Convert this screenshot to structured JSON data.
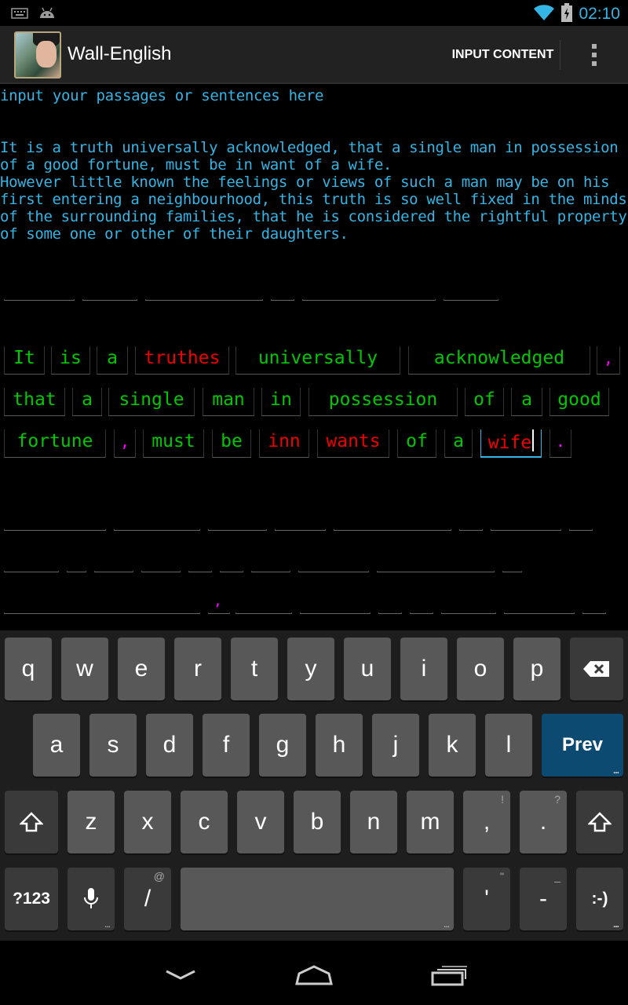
{
  "status_bar": {
    "time": "02:10",
    "icons": [
      "keyboard-icon",
      "android-icon",
      "wifi-icon",
      "battery-icon"
    ]
  },
  "action_bar": {
    "title": "Wall-English",
    "action_label": "INPUT CONTENT",
    "overflow_icon": "overflow-menu-icon"
  },
  "content": {
    "prompt": "input your passages or sentences here",
    "passage": "It is a truth universally acknowledged, that a single man in possession\nof a good fortune, must be in want of a wife.\nHowever little known the feelings or views of such a man may be on his\nfirst entering a neighbourhood, this truth is so well fixed in the minds\nof the surrounding families, that he is considered the rightful property\nof some one or other of their daughters.",
    "words_row1": [
      "It",
      "is",
      "a",
      "truthes",
      "universally",
      "acknowledged",
      ","
    ],
    "words_row2": [
      "that",
      "a",
      "single",
      "man",
      "in",
      "possession",
      "of",
      "a",
      "good"
    ],
    "words_row3": [
      "fortune",
      ",",
      "must",
      "be",
      "inn",
      "wants",
      "of",
      "a",
      "wife",
      "."
    ],
    "blank_comma": ",",
    "colors": {
      "correct": "#00c800",
      "wrong": "#f00000",
      "punct": "#ff00ff",
      "text": "#33b5e5"
    }
  },
  "keyboard": {
    "row1": [
      "q",
      "w",
      "e",
      "r",
      "t",
      "y",
      "u",
      "i",
      "o",
      "p"
    ],
    "row2": [
      "a",
      "s",
      "d",
      "f",
      "g",
      "h",
      "j",
      "k",
      "l"
    ],
    "row3": [
      "z",
      "x",
      "c",
      "v",
      "b",
      "n",
      "m",
      ",",
      "."
    ],
    "row3_hints": [
      "!",
      "?"
    ],
    "prev_label": "Prev",
    "symbols_label": "?123",
    "slash_label": "/",
    "slash_hint": "@",
    "apostrophe_label": "'",
    "apostrophe_hint": "\"",
    "dash_label": "-",
    "dash_hint": "_",
    "smiley_label": ":-)",
    "backspace_icon": "backspace-icon",
    "shift_icon": "shift-icon",
    "mic_icon": "microphone-icon"
  },
  "nav_bar": {
    "icons": [
      "back-icon",
      "home-icon",
      "recent-apps-icon"
    ]
  }
}
